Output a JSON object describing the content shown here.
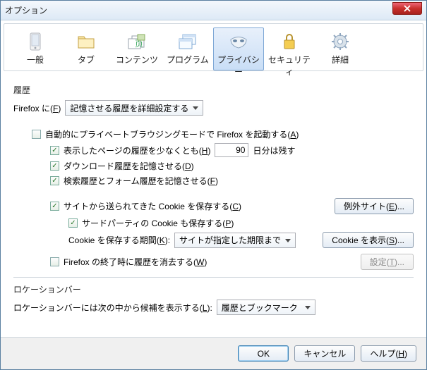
{
  "window": {
    "title": "オプション"
  },
  "categories": {
    "general": "一般",
    "tabs": "タブ",
    "content": "コンテンツ",
    "applications": "プログラム",
    "privacy": "プライバシー",
    "security": "セキュリティ",
    "advanced": "詳細"
  },
  "history": {
    "group_label": "履歴",
    "firefox_will_pre": "Firefox に(",
    "firefox_will_key": "F",
    "firefox_will_post": ")",
    "mode": "記憶させる履歴を詳細設定する",
    "private_browsing_pre": "自動的にプライベートブラウジングモードで Firefox を起動する(",
    "private_browsing_key": "A",
    "private_browsing_post": ")",
    "remember_history_pre": "表示したページの履歴を少なくとも(",
    "remember_history_key": "H",
    "remember_history_post": ")",
    "remember_history_days": "90",
    "remember_history_suffix": "日分は残す",
    "remember_download_pre": "ダウンロード履歴を記憶させる(",
    "remember_download_key": "D",
    "remember_download_post": ")",
    "remember_search_pre": "検索履歴とフォーム履歴を記憶させる(",
    "remember_search_key": "F",
    "remember_search_post": ")",
    "accept_cookies_pre": "サイトから送られてきた Cookie を保存する(",
    "accept_cookies_key": "C",
    "accept_cookies_post": ")",
    "exceptions_pre": "例外サイト(",
    "exceptions_key": "E",
    "exceptions_post": ")...",
    "third_party_pre": "サードパーティの Cookie も保存する(",
    "third_party_key": "P",
    "third_party_post": ")",
    "keep_until_pre": "Cookie を保存する期間(",
    "keep_until_key": "K",
    "keep_until_post": "):",
    "keep_until_value": "サイトが指定した期限まで",
    "show_cookies_pre": "Cookie を表示(",
    "show_cookies_key": "S",
    "show_cookies_post": ")...",
    "clear_on_close_pre": "Firefox の終了時に履歴を消去する(",
    "clear_on_close_key": "W",
    "clear_on_close_post": ")",
    "settings_pre": "設定(",
    "settings_key": "T",
    "settings_post": ")..."
  },
  "locationbar": {
    "group_label": "ロケーションバー",
    "suggest_pre": "ロケーションバーには次の中から候補を表示する(",
    "suggest_key": "L",
    "suggest_post": "):",
    "suggest_value": "履歴とブックマーク"
  },
  "buttons": {
    "ok": "OK",
    "cancel": "キャンセル",
    "help_pre": "ヘルプ(",
    "help_key": "H",
    "help_post": ")"
  }
}
